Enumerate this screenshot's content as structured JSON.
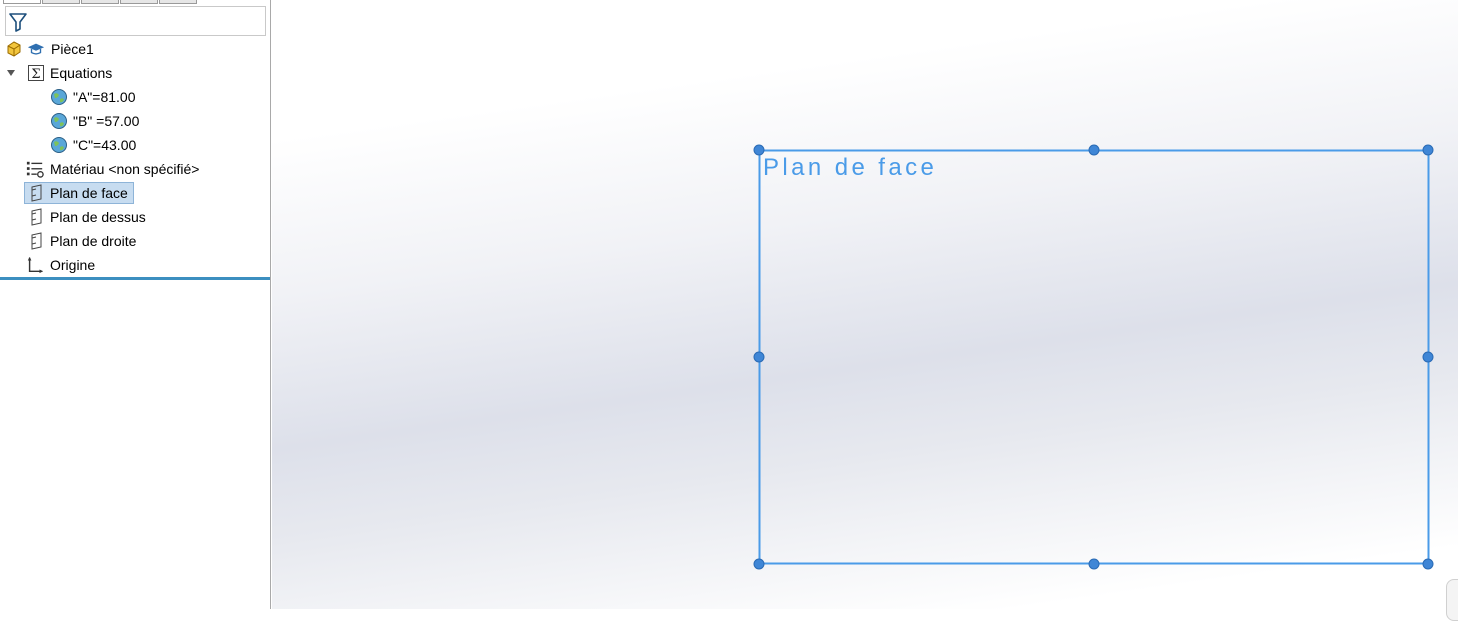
{
  "feature_tree": {
    "filter_icon": "filter-icon",
    "items": [
      {
        "label": "Pièce1",
        "icon": "part-icon",
        "expander": ""
      },
      {
        "label": "Equations",
        "icon": "equations-folder-icon",
        "expander": "expanded"
      },
      {
        "label": "\"A\"=81.00",
        "icon": "global-variable-icon"
      },
      {
        "label": "\"B\" =57.00",
        "icon": "global-variable-icon"
      },
      {
        "label": "\"C\"=43.00",
        "icon": "global-variable-icon"
      },
      {
        "label": "Matériau <non spécifié>",
        "icon": "material-icon"
      },
      {
        "label": "Plan de face",
        "icon": "plane-icon",
        "selected": true
      },
      {
        "label": "Plan de dessus",
        "icon": "plane-icon"
      },
      {
        "label": "Plan de droite",
        "icon": "plane-icon"
      },
      {
        "label": "Origine",
        "icon": "origin-icon"
      }
    ]
  },
  "viewport": {
    "plane_label": "Plan de face",
    "plane_color": "#4a9be8",
    "handle_color": "#3f86d6"
  }
}
